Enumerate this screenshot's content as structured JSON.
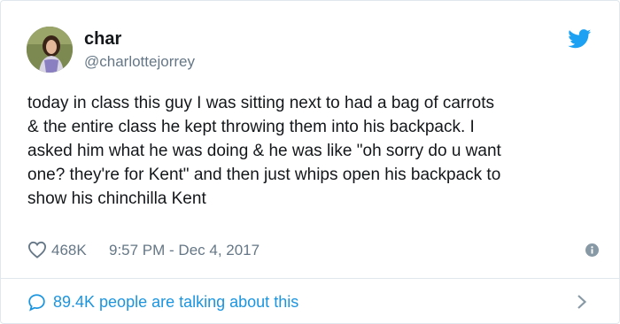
{
  "user": {
    "display_name": "char",
    "handle": "@charlottejorrey"
  },
  "tweet": {
    "text": "today in class this guy I was sitting next to had a bag of carrots\n& the entire class he kept throwing them into his backpack. I\nasked him what he was doing & he was like \"oh sorry do u want\none? they're for Kent\" and then just whips open his backpack to\nshow his chinchilla Kent"
  },
  "meta": {
    "likes": "468K",
    "timestamp": "9:57 PM - Dec 4, 2017"
  },
  "footer": {
    "talking": "89.4K people are talking about this"
  },
  "icons": {
    "avatar": "avatar-photo",
    "brand": "twitter-bird-icon",
    "like": "heart-icon",
    "info": "info-icon",
    "comment": "comment-icon",
    "more": "chevron-right-icon"
  },
  "colors": {
    "brand": "#1da1f2",
    "link": "#1b95e0",
    "secondary_text": "#657786",
    "primary_text": "#14171a",
    "border": "#e1e8ed"
  }
}
